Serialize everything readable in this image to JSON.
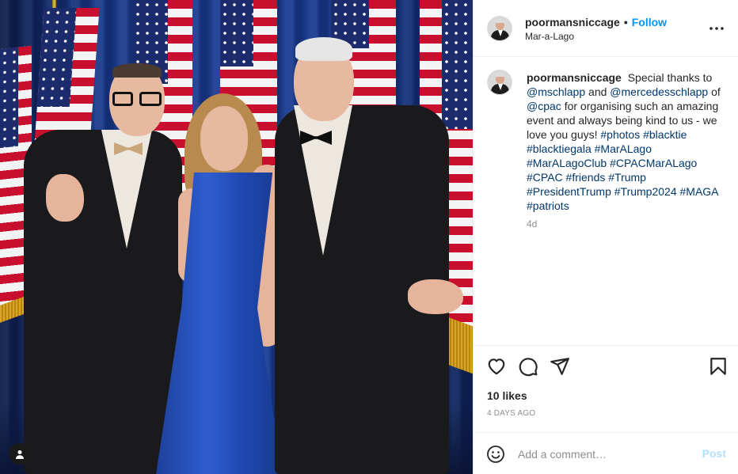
{
  "photo": {
    "alt": "",
    "profile_badge_icon": "user-icon"
  },
  "post": {
    "username": "poormansniccage",
    "separator": "•",
    "follow_label": "Follow",
    "location": "Mar-a-Lago",
    "more_icon": "more-horizontal-icon"
  },
  "caption": {
    "username": "poormansniccage",
    "text_1": "Special thanks to",
    "mention_1": "@mschlapp",
    "text_2": "and",
    "mention_2": "@mercedesschlapp",
    "text_3": "of",
    "mention_3": "@cpac",
    "text_4": "for organising such an amazing event and always being kind to us - we love you guys!",
    "hashtags": [
      "#photos",
      "#blacktie",
      "#blacktiegala",
      "#MarALago",
      "#MarALagoClub",
      "#CPACMarALago",
      "#CPAC",
      "#friends",
      "#Trump",
      "#PresidentTrump",
      "#Trump2024",
      "#MAGA",
      "#patriots"
    ],
    "age": "4d"
  },
  "actions": {
    "like_icon": "heart-icon",
    "comment_icon": "comment-icon",
    "share_icon": "paper-plane-icon",
    "save_icon": "bookmark-icon",
    "likes": "10 likes",
    "date": "4 DAYS AGO"
  },
  "comment": {
    "emoji_icon": "smiley-icon",
    "placeholder": "Add a comment…",
    "post_label": "Post"
  },
  "colors": {
    "accent": "#0095f6",
    "link": "#00376b",
    "post_disabled": "#b2dffc",
    "muted": "#8e8e8e"
  }
}
